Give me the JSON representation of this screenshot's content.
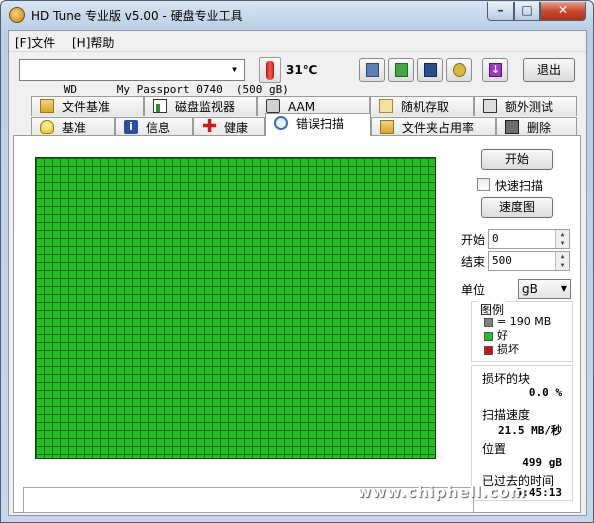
{
  "window": {
    "title": "HD Tune 专业版 v5.00 - 硬盘专业工具"
  },
  "menu": {
    "file": "[F]文件",
    "help": "[H]帮助"
  },
  "toolbar": {
    "drive": "WD      My Passport 0740  (500 gB)",
    "temperature": "31℃",
    "exit_label": "退出",
    "icons": [
      "copy-text-icon",
      "copy-screen-icon",
      "save-icon",
      "options-icon",
      "download-icon"
    ]
  },
  "tabs_row1": [
    "文件基准",
    "磁盘监视器",
    "AAM",
    "随机存取",
    "额外测试"
  ],
  "tabs_row2": [
    "基准",
    "信息",
    "健康",
    "错误扫描",
    "文件夹占用率",
    "删除"
  ],
  "active_tab": "错误扫描",
  "scan": {
    "start_button": "开始",
    "quick_scan_label": "快速扫描",
    "quick_scan_checked": false,
    "speed_map_button": "速度图",
    "start_label": "开始",
    "start_value": "0",
    "end_label": "结束",
    "end_value": "500",
    "unit_label": "单位",
    "unit_value": "gB",
    "legend_title": "图例",
    "legend": [
      {
        "label": "= 190 MB",
        "color": "#808080"
      },
      {
        "label": "好",
        "color": "#21c121"
      },
      {
        "label": "损坏",
        "color": "#cc1111"
      }
    ],
    "damaged_blocks_label": "损坏的块",
    "damaged_blocks_value": "0.0 %",
    "scan_speed_label": "扫描速度",
    "scan_speed_value": "21.5 MB/秒",
    "position_label": "位置",
    "position_value": "499 gB",
    "elapsed_label": "已过去的时间",
    "elapsed_value": "5:45:13"
  },
  "watermark": "www.chiphell.com",
  "colors": {
    "good_block": "#21c121",
    "grid_line": "#146b14",
    "damaged": "#cc1111"
  }
}
